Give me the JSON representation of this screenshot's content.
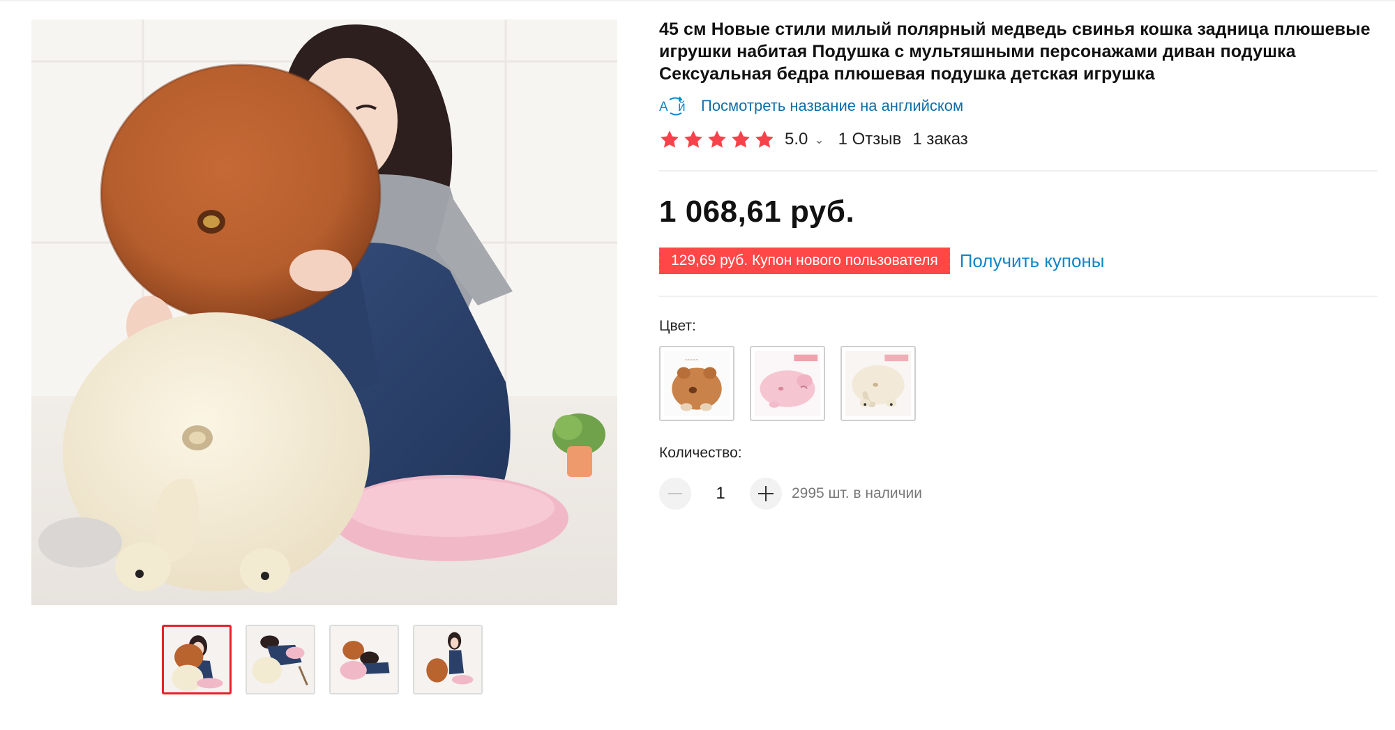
{
  "product": {
    "title": "45 см Новые стили милый полярный медведь свинья кошка задница плюшевые игрушки набитая Подушка с мультяшными персонажами диван подушка Сексуальная бедра плюшевая подушка детская игрушка",
    "translate_icon": "translate-icon",
    "translate_link": "Посмотреть название на английском"
  },
  "rating": {
    "stars": 5,
    "star_color": "#f5424b",
    "score": "5.0",
    "caret": "⌄",
    "reviews": "1 Отзыв",
    "orders": "1 заказ"
  },
  "price": {
    "value": "1 068,61 руб."
  },
  "coupon": {
    "badge": "129,69 руб. Купон нового пользователя",
    "link": "Получить купоны",
    "badge_color": "#ff4747",
    "link_color": "#0f86c6"
  },
  "options": {
    "color_label": "Цвет:",
    "color_variants": [
      "brown-bear-cushion",
      "pink-pig-cushion",
      "white-cat-cushion"
    ],
    "quantity_label": "Количество:"
  },
  "quantity": {
    "value": "1",
    "stock": "2995 шт. в наличии"
  },
  "gallery": {
    "thumbnail_count": 4,
    "active_thumbnail": 1,
    "accent_color": "#e62129"
  }
}
